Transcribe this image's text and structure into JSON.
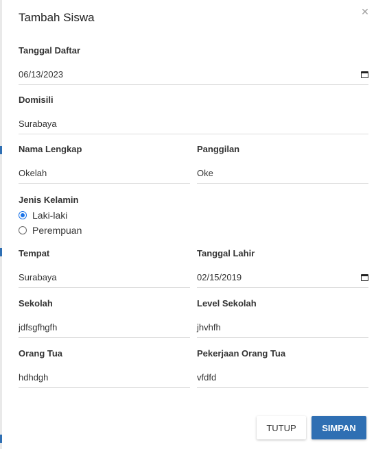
{
  "dialog": {
    "title": "Tambah Siswa"
  },
  "form": {
    "tanggal_daftar": {
      "label": "Tanggal Daftar",
      "value": "06/13/2023"
    },
    "domisili": {
      "label": "Domisili",
      "value": "Surabaya"
    },
    "nama_lengkap": {
      "label": "Nama Lengkap",
      "value": "Okelah"
    },
    "panggilan": {
      "label": "Panggilan",
      "value": "Oke"
    },
    "jenis_kelamin": {
      "label": "Jenis Kelamin",
      "options": [
        "Laki-laki",
        "Perempuan"
      ],
      "selected": "Laki-laki"
    },
    "tempat": {
      "label": "Tempat",
      "value": "Surabaya"
    },
    "tanggal_lahir": {
      "label": "Tanggal Lahir",
      "value": "02/15/2019"
    },
    "sekolah": {
      "label": "Sekolah",
      "value": "jdfsgfhgfh"
    },
    "level_sekolah": {
      "label": "Level Sekolah",
      "value": "jhvhfh"
    },
    "orang_tua": {
      "label": "Orang Tua",
      "value": "hdhdgh"
    },
    "pekerjaan_orang_tua": {
      "label": "Pekerjaan Orang Tua",
      "value": "vfdfd"
    }
  },
  "buttons": {
    "tutup": "TUTUP",
    "simpan": "SIMPAN"
  },
  "colors": {
    "primary": "#2f6fb3",
    "radio": "#1a73e8",
    "underline": "#dcdcdc"
  },
  "icons": {
    "close": "close-icon",
    "calendar": "calendar-icon"
  }
}
